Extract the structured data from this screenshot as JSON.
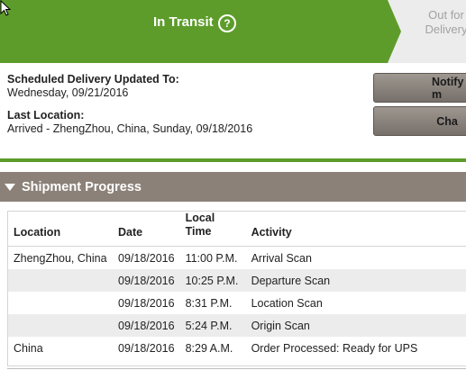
{
  "status": {
    "current_step": "In Transit",
    "help_symbol": "?",
    "next_step_line1": "Out for",
    "next_step_line2": "Delivery"
  },
  "delivery": {
    "scheduled_label": "Scheduled Delivery Updated To:",
    "scheduled_value": "Wednesday, 09/21/2016",
    "last_location_label": "Last Location:",
    "last_location_value": "Arrived - ZhengZhou, China, Sunday, 09/18/2016"
  },
  "buttons": {
    "notify": "Notify m",
    "change": "Cha"
  },
  "progress": {
    "title": "Shipment Progress",
    "headers": {
      "location": "Location",
      "date": "Date",
      "time_line1": "Local",
      "time_line2": "Time",
      "activity": "Activity"
    },
    "rows": [
      {
        "location": "ZhengZhou, China",
        "date": "09/18/2016",
        "time": "11:00 P.M.",
        "activity": "Arrival Scan"
      },
      {
        "location": "",
        "date": "09/18/2016",
        "time": "10:25 P.M.",
        "activity": "Departure Scan"
      },
      {
        "location": "",
        "date": "09/18/2016",
        "time": "8:31 P.M.",
        "activity": "Location Scan"
      },
      {
        "location": "",
        "date": "09/18/2016",
        "time": "5:24 P.M.",
        "activity": "Origin Scan"
      },
      {
        "location": "China",
        "date": "09/18/2016",
        "time": "8:29 A.M.",
        "activity": "Order Processed: Ready for UPS"
      }
    ]
  },
  "colors": {
    "brand_green": "#5d9c2a",
    "section_brown": "#8b8178",
    "row_stripe": "#ececec"
  }
}
